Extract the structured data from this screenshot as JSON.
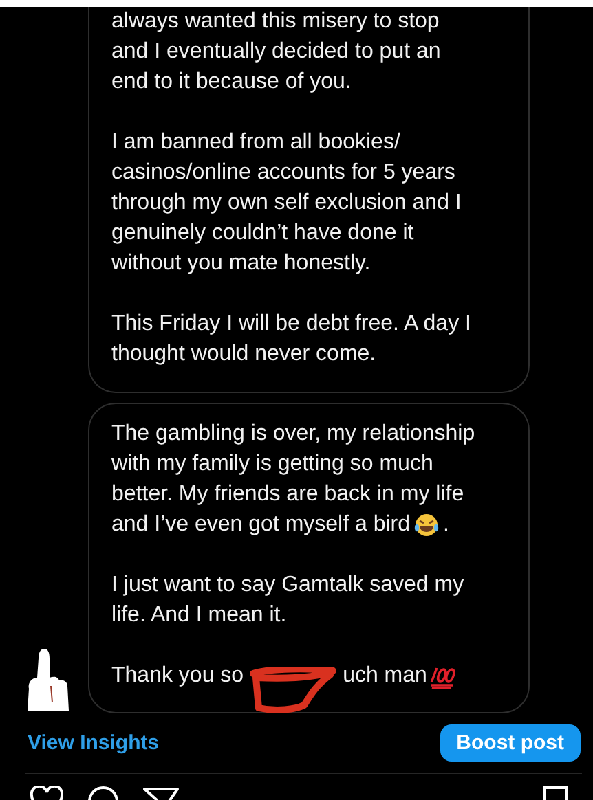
{
  "messages": [
    {
      "paragraphs": [
        {
          "kind": "plain",
          "text": "always wanted this misery to stop\nand I eventually decided to put an\nend to it because of you."
        },
        {
          "kind": "plain",
          "text": "I am banned from all bookies/\ncasinos/online accounts for 5 years\nthrough my own self exclusion and I\ngenuinely couldn’t have done it\nwithout you mate honestly."
        },
        {
          "kind": "plain",
          "text": "This Friday I will be debt free. A day I\nthought would never come."
        }
      ]
    },
    {
      "paragraphs": [
        {
          "kind": "laughing_end",
          "text": "The gambling is over, my relationship\nwith my family is getting so much\nbetter. My friends are back in my life\nand I’ve even got myself a bird",
          "tail": "."
        },
        {
          "kind": "plain",
          "text": "I just want to say Gamtalk saved my\nlife. And I mean it."
        },
        {
          "kind": "redacted_hundred",
          "text": "Thank you so",
          "tail": "uch man"
        }
      ]
    }
  ],
  "insights_link": "View Insights",
  "boost_button": "Boost post"
}
